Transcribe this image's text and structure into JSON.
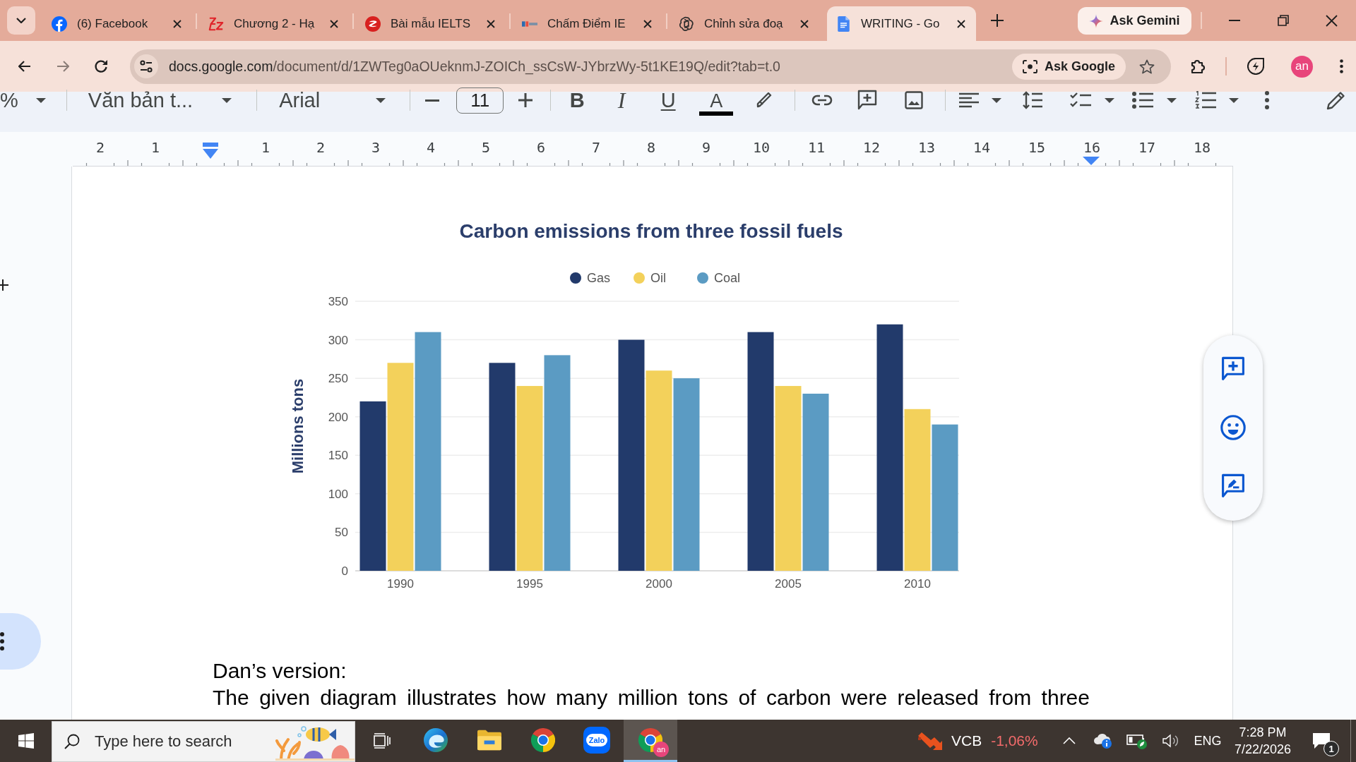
{
  "browser": {
    "tabs": [
      {
        "title": "(6) Facebook",
        "selected": false
      },
      {
        "title": "Chương 2 - Hạ",
        "selected": false
      },
      {
        "title": "Bài mẫu IELTS",
        "selected": false
      },
      {
        "title": "Chấm Điểm IE",
        "selected": false
      },
      {
        "title": "Chỉnh sửa đoạ",
        "selected": false
      },
      {
        "title": "WRITING - Go",
        "selected": true
      }
    ],
    "ask_gemini": "Ask Gemini",
    "address_bar": {
      "url_host": "docs.google.com",
      "url_path": "/document/d/1ZWTeg0aOUeknmJ-ZOICh_ssCsW-JYbrzWy-5t1KE19Q/edit?tab=t.0",
      "ask_google": "Ask Google"
    },
    "profile": "an"
  },
  "toolbar": {
    "zoom": "%",
    "paragraph_style": "Văn bản t...",
    "font": "Arial",
    "font_size": "11",
    "bold": "B",
    "italic": "I",
    "underline": "U",
    "text_color": "A"
  },
  "ruler": {
    "left_marks": [
      "2",
      "1"
    ],
    "marks": [
      "1",
      "2",
      "3",
      "4",
      "5",
      "6",
      "7",
      "8",
      "9",
      "10",
      "11",
      "12",
      "13",
      "14",
      "15",
      "16",
      "17",
      "18"
    ]
  },
  "document": {
    "chart_data": {
      "type": "bar",
      "title": "Carbon emissions from three fossil fuels",
      "ylabel": "Millions tons",
      "categories": [
        "1990",
        "1995",
        "2000",
        "2005",
        "2010"
      ],
      "series": [
        {
          "name": "Gas",
          "color": "#223a6b",
          "values": [
            220,
            270,
            300,
            310,
            320
          ]
        },
        {
          "name": "Oil",
          "color": "#f3d15b",
          "values": [
            270,
            240,
            260,
            240,
            210
          ]
        },
        {
          "name": "Coal",
          "color": "#5b9bc3",
          "values": [
            310,
            280,
            250,
            230,
            190
          ]
        }
      ],
      "ylim": [
        0,
        350
      ],
      "yticks": [
        0,
        50,
        100,
        150,
        200,
        250,
        300,
        350
      ],
      "grid": true,
      "legend": "top"
    },
    "paragraphs": [
      "Dan’s version:",
      "The given diagram illustrates how many million tons of carbon were released from three"
    ]
  },
  "taskbar": {
    "search": {
      "placeholder": "Type here to search"
    },
    "apps": [
      {
        "selected": false
      },
      {
        "selected": false
      },
      {
        "selected": false
      },
      {
        "label": "Zalo",
        "selected": false
      },
      {
        "badge": "an",
        "selected": true
      }
    ],
    "stock": {
      "symbol": "VCB",
      "change": "-1,06%"
    },
    "language": "ENG",
    "time": "7:28 PM",
    "date": "7/22/2026",
    "notifications": "1"
  }
}
